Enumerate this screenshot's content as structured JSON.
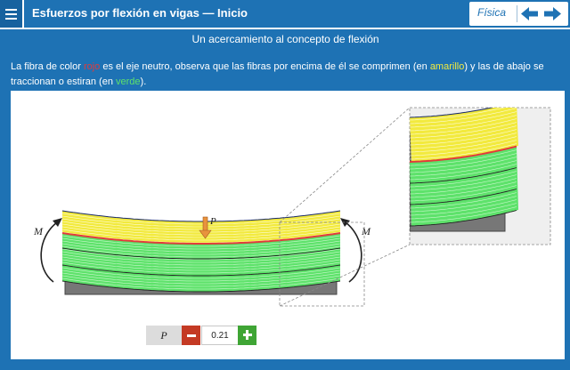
{
  "header": {
    "title": "Esfuerzos por flexión en vigas  —  Inicio",
    "subject": "Física"
  },
  "content": {
    "subtitle": "Un acercamiento al concepto de flexión",
    "desc": {
      "part1": "La fibra de color ",
      "red_word": "rojo",
      "part2": " es el eje neutro, observa que las fibras por encima de él se comprimen (en ",
      "yellow_word": "amarillo",
      "part3": ") y las de abajo se traccionan o estiran (en ",
      "green_word": "verde",
      "part4": ")."
    }
  },
  "diagram": {
    "moment_label_left": "M",
    "moment_label_right": "M",
    "load_label": "P"
  },
  "control": {
    "label": "P",
    "value": "0.21"
  },
  "colors": {
    "header_bg": "#1e72b4",
    "neutral_axis": "#e23b3b",
    "compression": "#f2ea3e",
    "tension": "#5ee26b",
    "minus_button": "#c43a24",
    "plus_button": "#3fa535"
  }
}
